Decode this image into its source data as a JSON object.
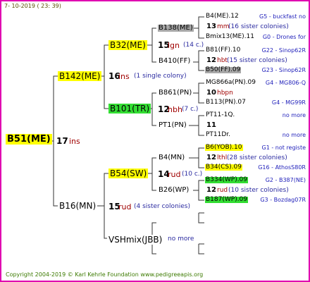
{
  "header": "7-  10-2019  (  23:  39)",
  "footer": "Copyright 2004-2019 © Karl Kehrle Foundation    www.pedigreeapis.org",
  "root": {
    "name": "B51(ME)",
    "count": "17",
    "ins": "ins"
  },
  "gen1": [
    {
      "name": "B142(ME)",
      "count": "16",
      "ins": "ins",
      "note": "(1 single colony)"
    },
    {
      "name": "B16(MN)",
      "count": "15",
      "ins": "rud",
      "note": "(4 sister colonies)"
    }
  ],
  "gen2": [
    {
      "name": "B32(ME)",
      "count": "15",
      "ins": "lgn",
      "note": "(14 c.)"
    },
    {
      "name": "B101(TR)",
      "count": "12",
      "ins": "hbh",
      "note": "(7 c.)"
    },
    {
      "name": "B54(SW)",
      "count": "14",
      "ins": "rud",
      "note": "(10 c.)"
    },
    {
      "name": "VSHmix(JBB)",
      "note": "no more"
    }
  ],
  "gen3": [
    {
      "name": "B138(ME)"
    },
    {
      "name": "B410(FF)"
    },
    {
      "name": "B861(PN)"
    },
    {
      "name": "PT1(PN)"
    },
    {
      "name": "B4(MN)"
    },
    {
      "name": "B26(WP)"
    }
  ],
  "gen4": [
    {
      "top": "B4(ME).12",
      "top_right": "G5 - buckfast no",
      "count": "13",
      "ins": "mm",
      "note": "(16 sister colonies)",
      "bottom": "Bmix13(ME).11",
      "bottom_right": "G0 - Drones for"
    },
    {
      "top": "B81(FF).10",
      "top_right": "G22 - Sinop62R",
      "count": "12",
      "ins": "hbt",
      "note": "(15 sister colonies)",
      "bottom": "B50(FF).09",
      "bottom_right": "G23 - Sinop62R"
    },
    {
      "top": "MG866a(PN).09",
      "top_right": "G4 - MG806-Q",
      "count": "10",
      "ins": "hbpn",
      "note": "",
      "bottom": "B113(PN).07",
      "bottom_right": "G4 - MG99R"
    },
    {
      "top": "PT11-1Q.",
      "top_right": "no more",
      "count": "11",
      "ins": "",
      "note": "",
      "bottom": "PT11Dr.",
      "bottom_right": "no more"
    },
    {
      "top": "B6(YOB).10",
      "top_right": "G1 - not registe",
      "count": "12",
      "ins": "lthl",
      "note": "(28 sister colonies)",
      "bottom": "B34(CS).09",
      "bottom_right": "G16 - AthosS80R"
    },
    {
      "top": "B334(WP).09",
      "top_right": "G2 - B387(NE)",
      "count": "12",
      "ins": "rud",
      "note": "(10 sister colonies)",
      "bottom": "B187(WP).09",
      "bottom_right": "G3 - Bozdag07R"
    }
  ]
}
